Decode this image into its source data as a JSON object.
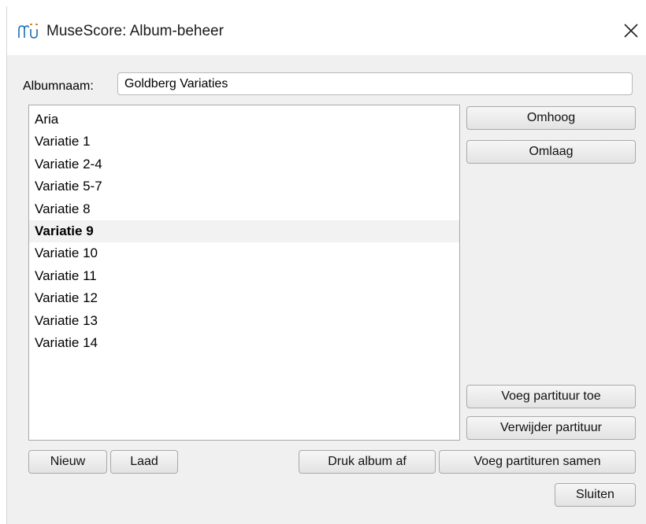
{
  "window": {
    "title": "MuseScore: Album-beheer",
    "close_symbol": "✕",
    "app_icon": "musescore-icon",
    "close_icon": "close-icon"
  },
  "album": {
    "name_label": "Albumnaam:",
    "name_value": "Goldberg Variaties"
  },
  "scores": {
    "items": [
      "Aria",
      "Variatie 1",
      "Variatie 2-4",
      "Variatie 5-7",
      "Variatie 8",
      "Variatie 9",
      "Variatie 10",
      "Variatie 11",
      "Variatie 12",
      "Variatie 13",
      "Variatie 14"
    ],
    "selected": "Variatie 9"
  },
  "buttons": {
    "up": "Omhoog",
    "down": "Omlaag",
    "add_score": "Voeg partituur toe",
    "remove_score": "Verwijder partituur",
    "new": "Nieuw",
    "load": "Laad",
    "print_album": "Druk album af",
    "join_scores": "Voeg partituren samen",
    "close": "Sluiten"
  },
  "colors": {
    "dialog_bg": "#f0f0f0",
    "titlebar_bg": "#ffffff",
    "icon_blue": "#1a6fb5"
  }
}
